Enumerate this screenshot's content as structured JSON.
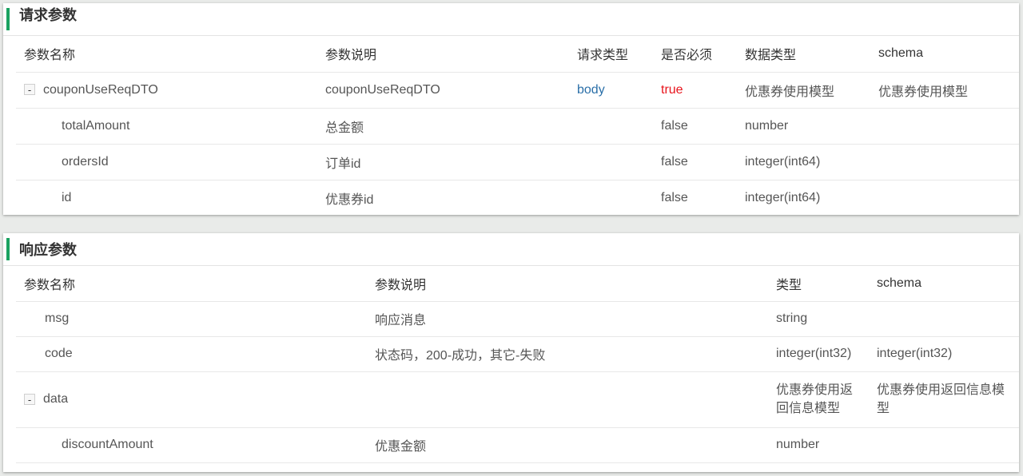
{
  "request": {
    "title": "请求参数",
    "headers": [
      "参数名称",
      "参数说明",
      "请求类型",
      "是否必须",
      "数据类型",
      "schema"
    ],
    "rows": [
      {
        "toggle": "-",
        "name": "couponUseReqDTO",
        "desc": "couponUseReqDTO",
        "in": "body",
        "required": "true",
        "type": "优惠券使用模型",
        "schema": "优惠券使用模型"
      },
      {
        "name": "totalAmount",
        "desc": "总金额",
        "in": "",
        "required": "false",
        "type": "number",
        "schema": ""
      },
      {
        "name": "ordersId",
        "desc": "订单id",
        "in": "",
        "required": "false",
        "type": "integer(int64)",
        "schema": ""
      },
      {
        "name": "id",
        "desc": "优惠券id",
        "in": "",
        "required": "false",
        "type": "integer(int64)",
        "schema": ""
      }
    ],
    "colors": {
      "in": "#2a6fa8",
      "required_true": "#e8141c"
    }
  },
  "response": {
    "title": "响应参数",
    "headers": [
      "参数名称",
      "参数说明",
      "类型",
      "schema"
    ],
    "rows": [
      {
        "name": "msg",
        "desc": "响应消息",
        "type": "string",
        "schema": ""
      },
      {
        "name": "code",
        "desc": "状态码，200-成功，其它-失败",
        "type": "integer(int32)",
        "schema": "integer(int32)"
      },
      {
        "toggle": "-",
        "name": "data",
        "desc": "",
        "type": "优惠券使用返回信息模型",
        "schema": "优惠券使用返回信息模型"
      },
      {
        "name": "discountAmount",
        "desc": "优惠金额",
        "type": "number",
        "schema": ""
      }
    ]
  },
  "accent_color": "#1aa260"
}
